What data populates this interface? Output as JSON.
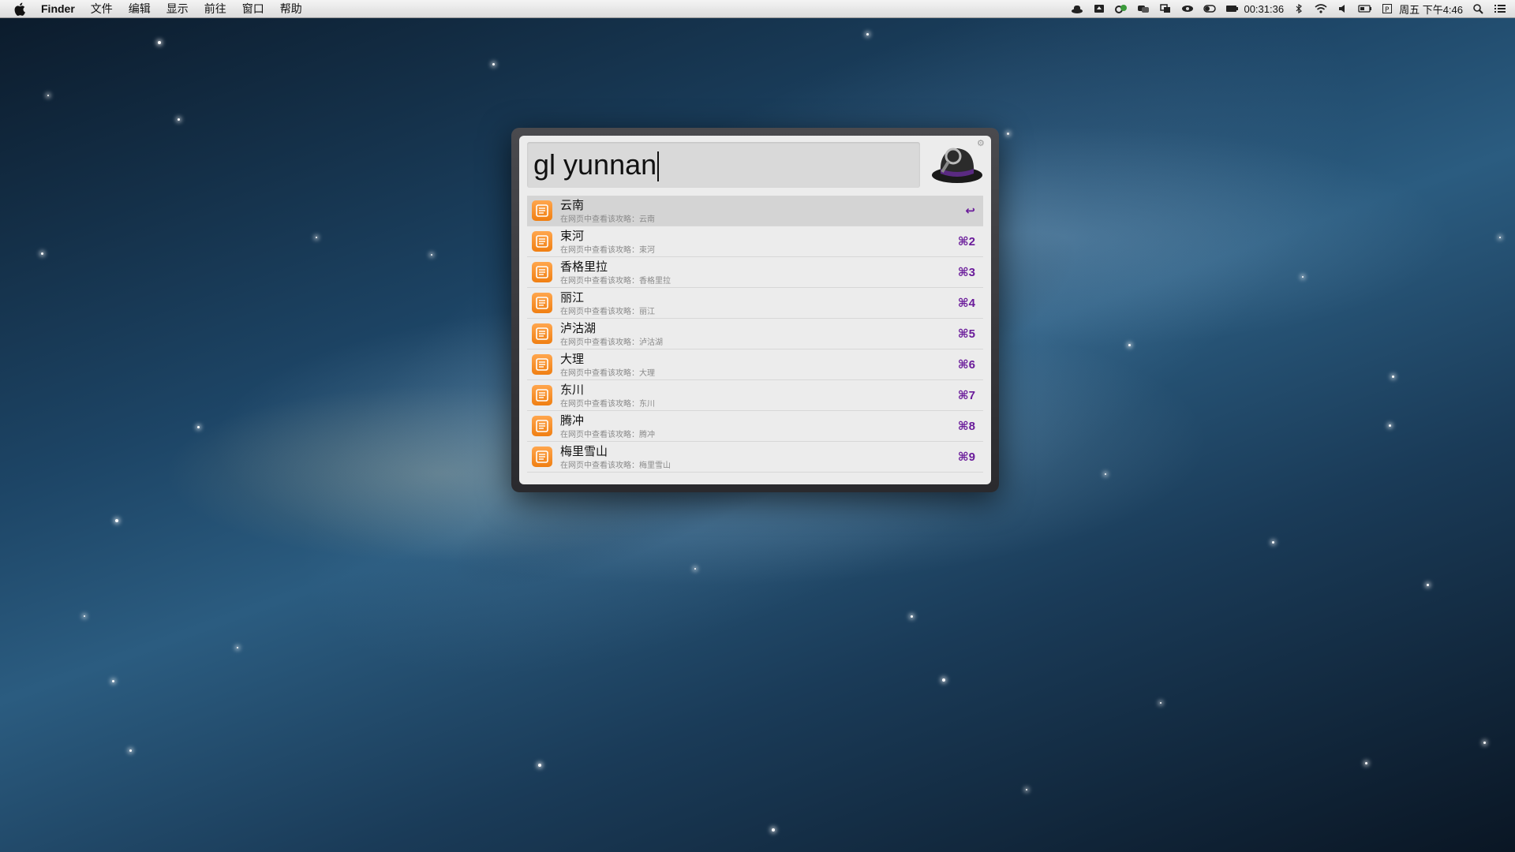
{
  "menubar": {
    "app_name": "Finder",
    "menus": [
      "文件",
      "编辑",
      "显示",
      "前往",
      "窗口",
      "帮助"
    ],
    "timer": "00:31:36",
    "datetime": "周五 下午4:46"
  },
  "alfred": {
    "query": "gl yunnan",
    "results": [
      {
        "title": "云南",
        "subtitle": "在网页中查看该攻略：云南",
        "shortcut": "↩"
      },
      {
        "title": "束河",
        "subtitle": "在网页中查看该攻略：束河",
        "shortcut": "⌘2"
      },
      {
        "title": "香格里拉",
        "subtitle": "在网页中查看该攻略：香格里拉",
        "shortcut": "⌘3"
      },
      {
        "title": "丽江",
        "subtitle": "在网页中查看该攻略：丽江",
        "shortcut": "⌘4"
      },
      {
        "title": "泸沽湖",
        "subtitle": "在网页中查看该攻略：泸沽湖",
        "shortcut": "⌘5"
      },
      {
        "title": "大理",
        "subtitle": "在网页中查看该攻略：大理",
        "shortcut": "⌘6"
      },
      {
        "title": "东川",
        "subtitle": "在网页中查看该攻略：东川",
        "shortcut": "⌘7"
      },
      {
        "title": "腾冲",
        "subtitle": "在网页中查看该攻略：腾冲",
        "shortcut": "⌘8"
      },
      {
        "title": "梅里雪山",
        "subtitle": "在网页中查看该攻略：梅里雪山",
        "shortcut": "⌘9"
      }
    ],
    "result_icon": "guide-icon",
    "accent_color": "#6a1b9a"
  }
}
